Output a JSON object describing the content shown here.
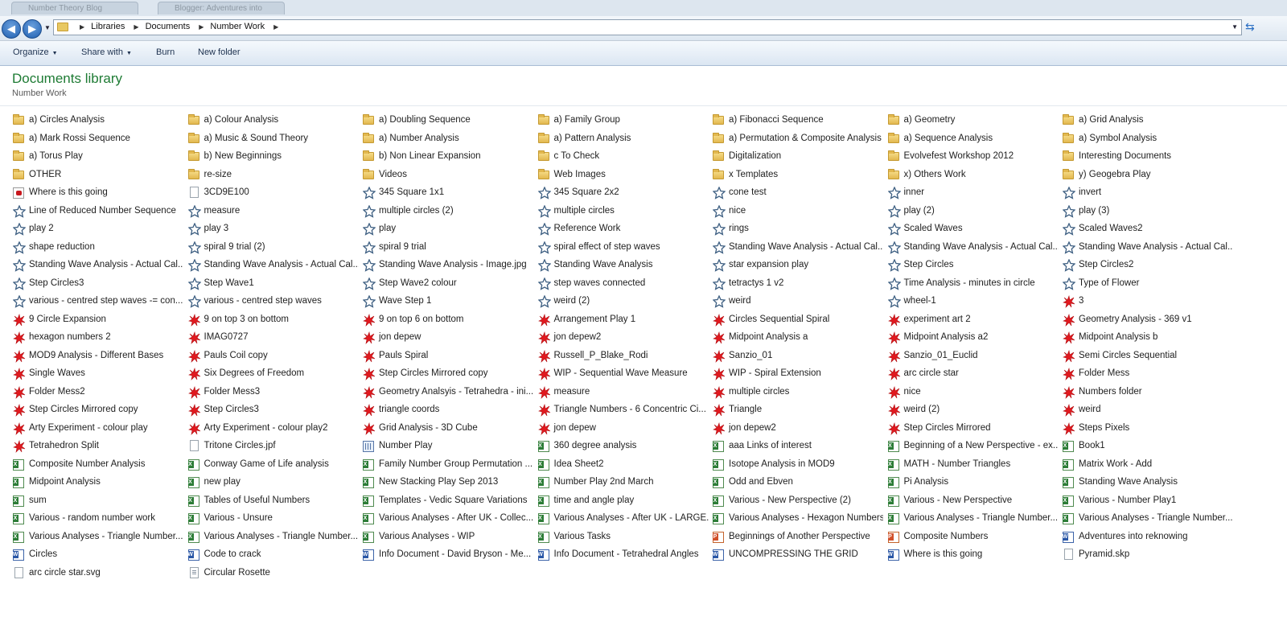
{
  "browser_tabs": [
    "Number Theory Blog",
    "Blogger: Adventures into"
  ],
  "nav": {
    "back_label": "Back",
    "forward_label": "Forward"
  },
  "address": {
    "crumbs": [
      "Libraries",
      "Documents",
      "Number Work"
    ]
  },
  "toolbar": {
    "organize": "Organize",
    "share_with": "Share with",
    "burn": "Burn",
    "new_folder": "New folder"
  },
  "library": {
    "title": "Documents library",
    "subtitle": "Number Work"
  },
  "icon_names": {
    "folder": "folder-icon",
    "pdf": "pdf-file-icon",
    "file": "blank-file-icon",
    "gif": "gif-image-icon",
    "red": "red-image-icon",
    "excel": "excel-file-icon",
    "word": "word-file-icon",
    "ppt": "powerpoint-file-icon",
    "numbers": "numbers-file-icon",
    "rtf": "text-document-icon"
  },
  "files": [
    {
      "name": "a) Circles Analysis",
      "type": "folder"
    },
    {
      "name": "a) Colour Analysis",
      "type": "folder"
    },
    {
      "name": "a) Doubling Sequence",
      "type": "folder"
    },
    {
      "name": "a) Family Group",
      "type": "folder"
    },
    {
      "name": "a) Fibonacci Sequence",
      "type": "folder"
    },
    {
      "name": "a) Geometry",
      "type": "folder"
    },
    {
      "name": "a) Grid Analysis",
      "type": "folder"
    },
    {
      "name": "a) Mark Rossi Sequence",
      "type": "folder"
    },
    {
      "name": "a) Music & Sound Theory",
      "type": "folder"
    },
    {
      "name": "a) Number Analysis",
      "type": "folder"
    },
    {
      "name": "a) Pattern Analysis",
      "type": "folder"
    },
    {
      "name": "a) Permutation & Composite Analysis",
      "type": "folder"
    },
    {
      "name": "a) Sequence Analysis",
      "type": "folder"
    },
    {
      "name": "a) Symbol Analysis",
      "type": "folder"
    },
    {
      "name": "a) Torus Play",
      "type": "folder"
    },
    {
      "name": "b) New Beginnings",
      "type": "folder"
    },
    {
      "name": "b) Non Linear Expansion",
      "type": "folder"
    },
    {
      "name": "c   To Check",
      "type": "folder"
    },
    {
      "name": "Digitalization",
      "type": "folder"
    },
    {
      "name": "Evolvefest Workshop 2012",
      "type": "folder"
    },
    {
      "name": "Interesting Documents",
      "type": "folder"
    },
    {
      "name": "OTHER",
      "type": "folder"
    },
    {
      "name": "re-size",
      "type": "folder"
    },
    {
      "name": "Videos",
      "type": "folder"
    },
    {
      "name": "Web Images",
      "type": "folder"
    },
    {
      "name": "x Templates",
      "type": "folder"
    },
    {
      "name": "x) Others Work",
      "type": "folder"
    },
    {
      "name": "y) Geogebra Play",
      "type": "folder"
    },
    {
      "name": "Where is this going",
      "type": "pdf"
    },
    {
      "name": "3CD9E100",
      "type": "file"
    },
    {
      "name": "345 Square 1x1",
      "type": "gif"
    },
    {
      "name": "345 Square 2x2",
      "type": "gif"
    },
    {
      "name": "cone test",
      "type": "gif"
    },
    {
      "name": "inner",
      "type": "gif"
    },
    {
      "name": "invert",
      "type": "gif"
    },
    {
      "name": "Line of Reduced Number Sequence",
      "type": "gif"
    },
    {
      "name": "measure",
      "type": "gif"
    },
    {
      "name": "multiple circles (2)",
      "type": "gif"
    },
    {
      "name": "multiple circles",
      "type": "gif"
    },
    {
      "name": "nice",
      "type": "gif"
    },
    {
      "name": "play (2)",
      "type": "gif"
    },
    {
      "name": "play (3)",
      "type": "gif"
    },
    {
      "name": "play 2",
      "type": "gif"
    },
    {
      "name": "play 3",
      "type": "gif"
    },
    {
      "name": "play",
      "type": "gif"
    },
    {
      "name": "Reference Work",
      "type": "gif"
    },
    {
      "name": "rings",
      "type": "gif"
    },
    {
      "name": "Scaled Waves",
      "type": "gif"
    },
    {
      "name": "Scaled Waves2",
      "type": "gif"
    },
    {
      "name": "shape reduction",
      "type": "gif"
    },
    {
      "name": "spiral 9 trial (2)",
      "type": "gif"
    },
    {
      "name": "spiral 9 trial",
      "type": "gif"
    },
    {
      "name": "spiral effect of step waves",
      "type": "gif"
    },
    {
      "name": "Standing Wave Analysis - Actual Cal...",
      "type": "gif"
    },
    {
      "name": "Standing Wave Analysis - Actual Cal...",
      "type": "gif"
    },
    {
      "name": "Standing Wave Analysis - Actual Cal...",
      "type": "gif"
    },
    {
      "name": "Standing Wave Analysis - Actual Cal...",
      "type": "gif"
    },
    {
      "name": "Standing Wave Analysis - Actual Cal...",
      "type": "gif"
    },
    {
      "name": "Standing Wave Analysis - Image.jpg",
      "type": "gif"
    },
    {
      "name": "Standing Wave Analysis",
      "type": "gif"
    },
    {
      "name": "star expansion play",
      "type": "gif"
    },
    {
      "name": "Step Circles",
      "type": "gif"
    },
    {
      "name": "Step Circles2",
      "type": "gif"
    },
    {
      "name": "Step Circles3",
      "type": "gif"
    },
    {
      "name": "Step Wave1",
      "type": "gif"
    },
    {
      "name": "Step Wave2 colour",
      "type": "gif"
    },
    {
      "name": "step waves connected",
      "type": "gif"
    },
    {
      "name": "tetractys 1 v2",
      "type": "gif"
    },
    {
      "name": "Time Analysis - minutes in circle",
      "type": "gif"
    },
    {
      "name": "Type of Flower",
      "type": "gif"
    },
    {
      "name": "various - centred step waves -= con...",
      "type": "gif"
    },
    {
      "name": "various - centred step waves",
      "type": "gif"
    },
    {
      "name": "Wave Step 1",
      "type": "gif"
    },
    {
      "name": "weird (2)",
      "type": "gif"
    },
    {
      "name": "weird",
      "type": "gif"
    },
    {
      "name": "wheel-1",
      "type": "gif"
    },
    {
      "name": "3",
      "type": "red"
    },
    {
      "name": "9 Circle Expansion",
      "type": "red"
    },
    {
      "name": "9 on top 3 on bottom",
      "type": "red"
    },
    {
      "name": "9 on top 6 on bottom",
      "type": "red"
    },
    {
      "name": "Arrangement Play 1",
      "type": "red"
    },
    {
      "name": "Circles Sequential Spiral",
      "type": "red"
    },
    {
      "name": "experiment art 2",
      "type": "red"
    },
    {
      "name": "Geometry Analysis - 369 v1",
      "type": "red"
    },
    {
      "name": "hexagon numbers 2",
      "type": "red"
    },
    {
      "name": "IMAG0727",
      "type": "red"
    },
    {
      "name": "jon depew",
      "type": "red"
    },
    {
      "name": "jon depew2",
      "type": "red"
    },
    {
      "name": "Midpoint Analysis a",
      "type": "red"
    },
    {
      "name": "Midpoint Analysis a2",
      "type": "red"
    },
    {
      "name": "Midpoint Analysis b",
      "type": "red"
    },
    {
      "name": "MOD9 Analysis - Different Bases",
      "type": "red"
    },
    {
      "name": "Pauls Coil copy",
      "type": "red"
    },
    {
      "name": "Pauls Spiral",
      "type": "red"
    },
    {
      "name": "Russell_P_Blake_Rodi",
      "type": "red"
    },
    {
      "name": "Sanzio_01",
      "type": "red"
    },
    {
      "name": "Sanzio_01_Euclid",
      "type": "red"
    },
    {
      "name": "Semi Circles Sequential",
      "type": "red"
    },
    {
      "name": "Single Waves",
      "type": "red"
    },
    {
      "name": "Six Degrees of Freedom",
      "type": "red"
    },
    {
      "name": "Step Circles Mirrored copy",
      "type": "red"
    },
    {
      "name": "WIP - Sequential Wave Measure",
      "type": "red"
    },
    {
      "name": "WIP - Spiral Extension",
      "type": "red"
    },
    {
      "name": "arc circle star",
      "type": "red"
    },
    {
      "name": "Folder Mess",
      "type": "red"
    },
    {
      "name": "Folder Mess2",
      "type": "red"
    },
    {
      "name": "Folder Mess3",
      "type": "red"
    },
    {
      "name": "Geometry Analsyis - Tetrahedra - ini...",
      "type": "red"
    },
    {
      "name": "measure",
      "type": "red"
    },
    {
      "name": "multiple circles",
      "type": "red"
    },
    {
      "name": "nice",
      "type": "red"
    },
    {
      "name": "Numbers folder",
      "type": "red"
    },
    {
      "name": "Step Circles Mirrored copy",
      "type": "red"
    },
    {
      "name": "Step Circles3",
      "type": "red"
    },
    {
      "name": "triangle coords",
      "type": "red"
    },
    {
      "name": "Triangle Numbers - 6 Concentric Ci...",
      "type": "red"
    },
    {
      "name": "Triangle",
      "type": "red"
    },
    {
      "name": "weird (2)",
      "type": "red"
    },
    {
      "name": "weird",
      "type": "red"
    },
    {
      "name": "Arty Experiment - colour play",
      "type": "red"
    },
    {
      "name": "Arty Experiment - colour play2",
      "type": "red"
    },
    {
      "name": "Grid Analysis - 3D Cube",
      "type": "red"
    },
    {
      "name": "jon depew",
      "type": "red"
    },
    {
      "name": "jon depew2",
      "type": "red"
    },
    {
      "name": "Step Circles Mirrored",
      "type": "red"
    },
    {
      "name": "Steps Pixels",
      "type": "red"
    },
    {
      "name": "Tetrahedron Split",
      "type": "red"
    },
    {
      "name": "Tritone Circles.jpf",
      "type": "file"
    },
    {
      "name": "Number Play",
      "type": "numbers"
    },
    {
      "name": "360 degree analysis",
      "type": "excel"
    },
    {
      "name": "aaa Links of interest",
      "type": "excel"
    },
    {
      "name": "Beginning of a New Perspective - ex...",
      "type": "excel"
    },
    {
      "name": "Book1",
      "type": "excel"
    },
    {
      "name": "Composite Number Analysis",
      "type": "excel"
    },
    {
      "name": "Conway Game of Life analysis",
      "type": "excel"
    },
    {
      "name": "Family Number Group Permutation ...",
      "type": "excel"
    },
    {
      "name": "Idea Sheet2",
      "type": "excel"
    },
    {
      "name": "Isotope Analysis in MOD9",
      "type": "excel"
    },
    {
      "name": "MATH - Number Triangles",
      "type": "excel"
    },
    {
      "name": "Matrix Work - Add",
      "type": "excel"
    },
    {
      "name": "Midpoint Analysis",
      "type": "excel"
    },
    {
      "name": "new play",
      "type": "excel"
    },
    {
      "name": "New Stacking Play Sep 2013",
      "type": "excel"
    },
    {
      "name": "Number Play 2nd March",
      "type": "excel"
    },
    {
      "name": "Odd and Ebven",
      "type": "excel"
    },
    {
      "name": "Pi Analysis",
      "type": "excel"
    },
    {
      "name": "Standing Wave Analysis",
      "type": "excel"
    },
    {
      "name": "sum",
      "type": "excel"
    },
    {
      "name": "Tables of Useful Numbers",
      "type": "excel"
    },
    {
      "name": "Templates - Vedic Square Variations",
      "type": "excel"
    },
    {
      "name": "time and angle play",
      "type": "excel"
    },
    {
      "name": "Various - New Perspective (2)",
      "type": "excel"
    },
    {
      "name": "Various - New Perspective",
      "type": "excel"
    },
    {
      "name": "Various - Number Play1",
      "type": "excel"
    },
    {
      "name": "Various - random number work",
      "type": "excel"
    },
    {
      "name": "Various - Unsure",
      "type": "excel"
    },
    {
      "name": "Various Analyses - After UK - Collec...",
      "type": "excel"
    },
    {
      "name": "Various Analyses - After UK - LARGE...",
      "type": "excel"
    },
    {
      "name": "Various Analyses - Hexagon Numbers",
      "type": "excel"
    },
    {
      "name": "Various Analyses - Triangle Number...",
      "type": "excel"
    },
    {
      "name": "Various Analyses - Triangle Number...",
      "type": "excel"
    },
    {
      "name": "Various Analyses - Triangle Number...",
      "type": "excel"
    },
    {
      "name": "Various Analyses - Triangle Number...",
      "type": "excel"
    },
    {
      "name": "Various Analyses - WIP",
      "type": "excel"
    },
    {
      "name": "Various Tasks",
      "type": "excel"
    },
    {
      "name": "Beginnings of Another Perspective",
      "type": "ppt"
    },
    {
      "name": "Composite Numbers",
      "type": "ppt"
    },
    {
      "name": "Adventures into reknowing",
      "type": "word"
    },
    {
      "name": "Circles",
      "type": "word"
    },
    {
      "name": "Code to crack",
      "type": "word"
    },
    {
      "name": "Info Document - David Bryson - Me...",
      "type": "word"
    },
    {
      "name": "Info Document - Tetrahedral Angles",
      "type": "word"
    },
    {
      "name": "UNCOMPRESSING THE GRID",
      "type": "word"
    },
    {
      "name": "Where is this going",
      "type": "word"
    },
    {
      "name": "Pyramid.skp",
      "type": "file"
    },
    {
      "name": "arc circle star.svg",
      "type": "file"
    },
    {
      "name": "Circular Rosette",
      "type": "rtf"
    }
  ]
}
